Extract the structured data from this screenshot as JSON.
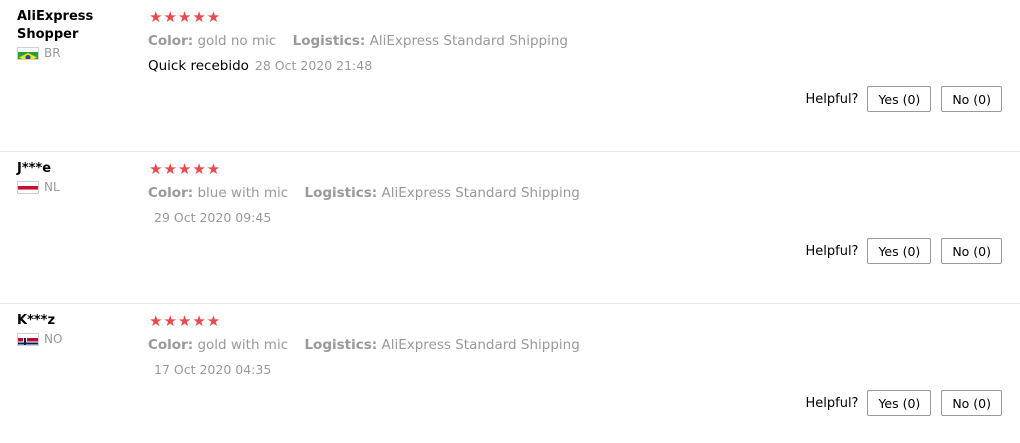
{
  "reviews": [
    {
      "user": "AliExpress Shopper",
      "country": "BR",
      "stars": "★★★★★",
      "color_label": "Color:",
      "color_value": "gold no mic",
      "logistics_label": "Logistics:",
      "logistics_value": "AliExpress Standard Shipping",
      "feedback": "Quick recebido",
      "date": "28 Oct 2020 21:48",
      "rating": 5,
      "helpful_label": "Helpful?",
      "yes_label": "Yes (0)",
      "no_label": "No (0)"
    },
    {
      "user": "J***e",
      "country": "NL",
      "stars": "★★★★★",
      "color_label": "Color:",
      "color_value": "blue with mic",
      "logistics_label": "Logistics:",
      "logistics_value": "AliExpress Standard Shipping",
      "feedback": "",
      "date": "29 Oct 2020 09:45",
      "rating": 5,
      "helpful_label": "Helpful?",
      "yes_label": "Yes (0)",
      "no_label": "No (0)"
    },
    {
      "user": "K***z",
      "country": "NO",
      "stars": "★★★★★",
      "color_label": "Color:",
      "color_value": "gold with mic",
      "logistics_label": "Logistics:",
      "logistics_value": "AliExpress Standard Shipping",
      "feedback": "",
      "date": "17 Oct 2020 04:35",
      "rating": 5,
      "helpful_label": "Helpful?",
      "yes_label": "Yes (0)",
      "no_label": "No (0)"
    }
  ],
  "colors": {
    "star": "#f04848",
    "muted": "#999999",
    "divider": "#e8e8e8"
  }
}
